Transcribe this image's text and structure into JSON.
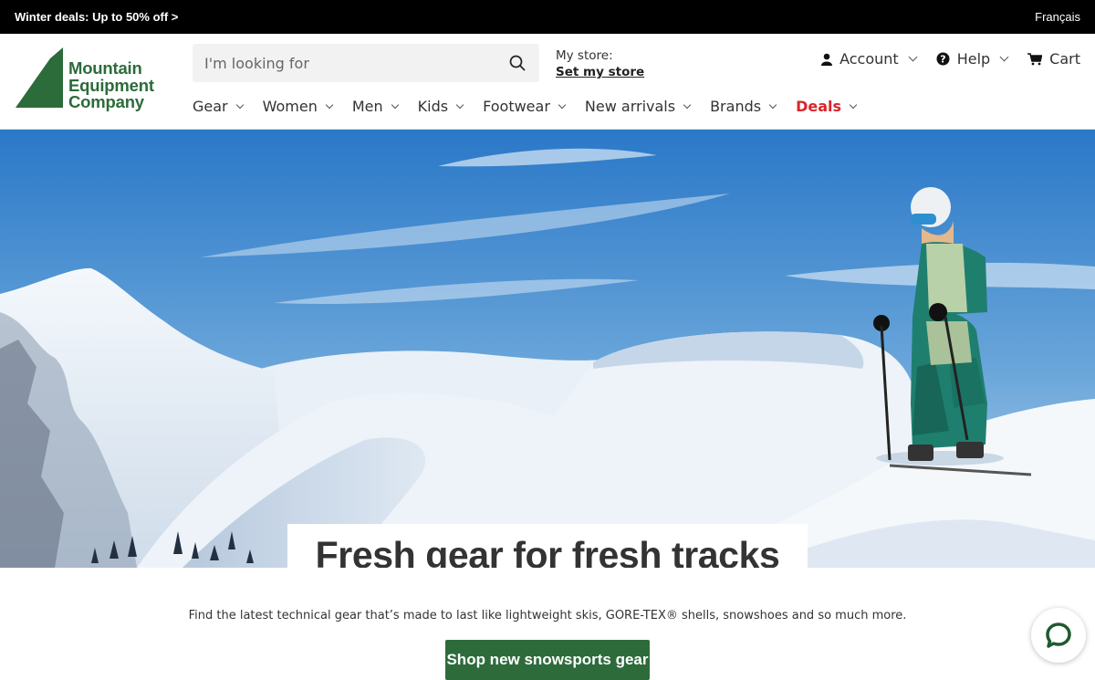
{
  "promo": {
    "deal_text": "Winter deals: Up to 50% off >",
    "language": "Français"
  },
  "logo": {
    "line1": "Mountain",
    "line2": "Equipment",
    "line3": "Company"
  },
  "search": {
    "placeholder": "I'm looking for"
  },
  "store": {
    "label": "My store:",
    "link": "Set my store"
  },
  "utility": {
    "account": "Account",
    "help": "Help",
    "cart": "Cart"
  },
  "nav": {
    "items": [
      {
        "label": "Gear"
      },
      {
        "label": "Women"
      },
      {
        "label": "Men"
      },
      {
        "label": "Kids"
      },
      {
        "label": "Footwear"
      },
      {
        "label": "New arrivals"
      },
      {
        "label": "Brands"
      },
      {
        "label": "Deals"
      }
    ]
  },
  "hero": {
    "headline": "Fresh gear for fresh tracks",
    "description": "Find the latest technical gear that’s made to last like lightweight skis, GORE-TEX® shells, snowshoes and so much more.",
    "cta": "Shop new snowsports gear"
  },
  "colors": {
    "brand_green": "#2e6b3b",
    "deals_red": "#d6272b",
    "promo_bg": "#000000"
  },
  "icons": {
    "search": "search-icon",
    "account": "user-icon",
    "help": "help-icon",
    "cart": "cart-icon",
    "chat": "chat-icon"
  }
}
